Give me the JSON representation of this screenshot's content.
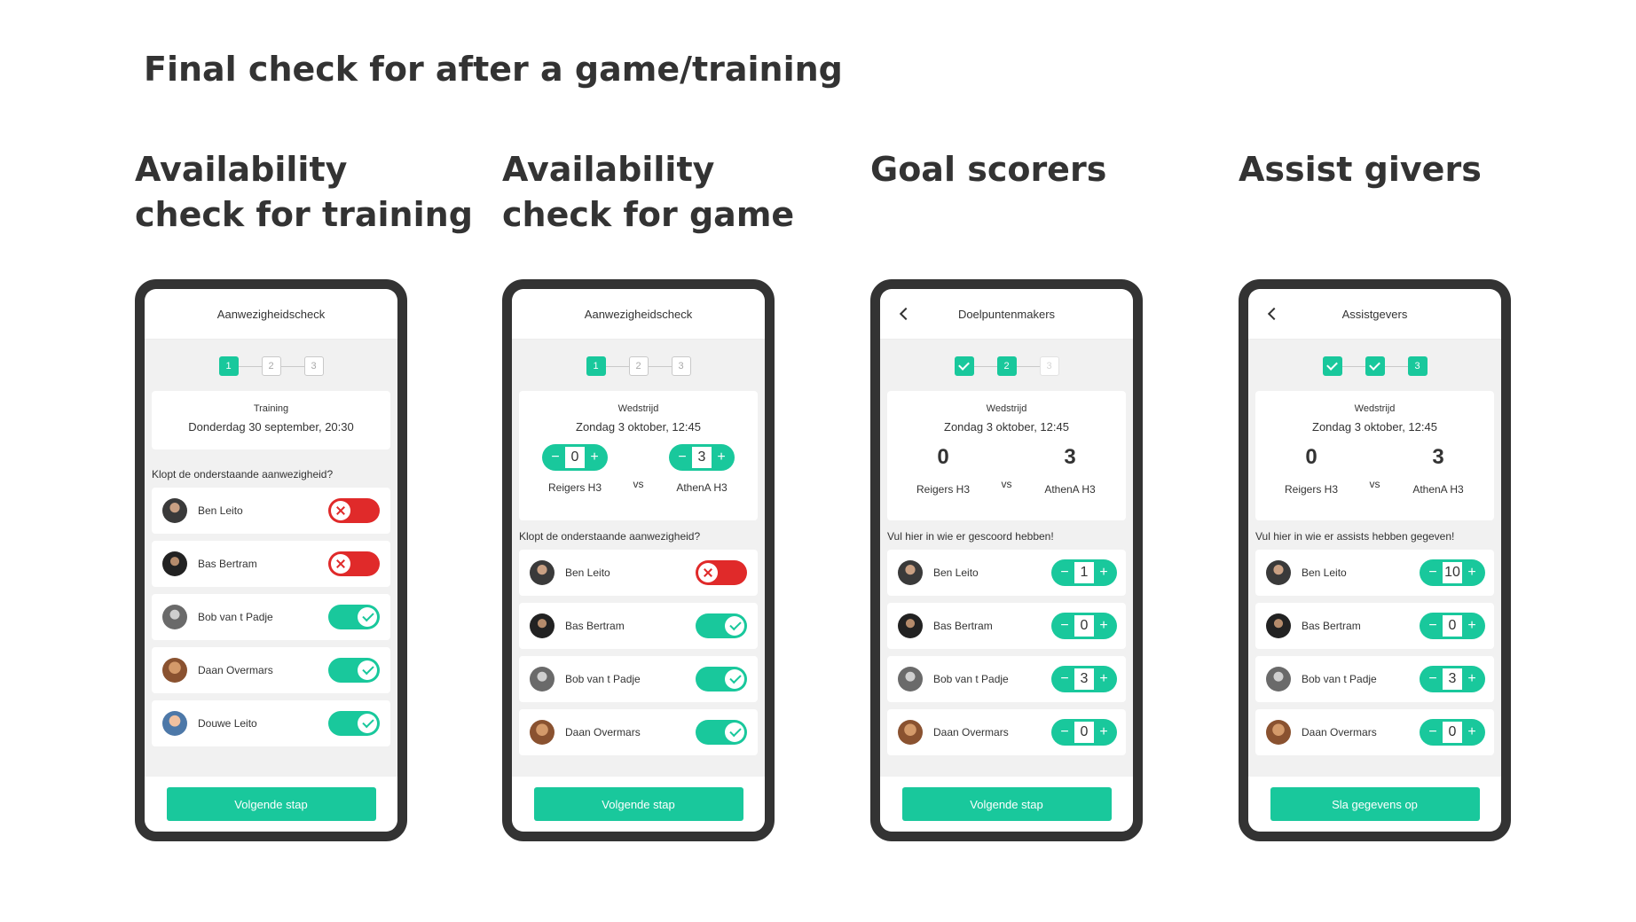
{
  "main_title": "Final check for after a game/training",
  "colors": {
    "accent": "#19c89c",
    "danger": "#e02a2a",
    "dark": "#333333"
  },
  "columns": [
    {
      "title": "Availability\ncheck for training"
    },
    {
      "title": "Availability\ncheck for game"
    },
    {
      "title": "Goal scorers"
    },
    {
      "title": "Assist givers"
    }
  ],
  "screens": [
    {
      "header": "Aanwezigheidscheck",
      "steps": [
        "1",
        "2",
        "3"
      ],
      "kind": "Training",
      "date": "Donderdag 30 september, 20:30",
      "question": "Klopt de onderstaande aanwezigheid?",
      "players": [
        {
          "name": "Ben Leito",
          "available": false
        },
        {
          "name": "Bas Bertram",
          "available": false
        },
        {
          "name": "Bob van t Padje",
          "available": true
        },
        {
          "name": "Daan Overmars",
          "available": true
        },
        {
          "name": "Douwe Leito",
          "available": true
        }
      ],
      "cta": "Volgende stap"
    },
    {
      "header": "Aanwezigheidscheck",
      "steps": [
        "1",
        "2",
        "3"
      ],
      "kind": "Wedstrijd",
      "date": "Zondag 3 oktober, 12:45",
      "home": {
        "name": "Reigers H3",
        "score": "0"
      },
      "away": {
        "name": "AthenA H3",
        "score": "3"
      },
      "vs": "vs",
      "question": "Klopt de onderstaande aanwezigheid?",
      "players": [
        {
          "name": "Ben Leito",
          "available": false
        },
        {
          "name": "Bas Bertram",
          "available": true
        },
        {
          "name": "Bob van t Padje",
          "available": true
        },
        {
          "name": "Daan Overmars",
          "available": true
        }
      ],
      "cta": "Volgende stap"
    },
    {
      "header": "Doelpuntenmakers",
      "steps": [
        "",
        "2",
        "3"
      ],
      "kind": "Wedstrijd",
      "date": "Zondag 3 oktober, 12:45",
      "home": {
        "name": "Reigers H3",
        "score": "0"
      },
      "away": {
        "name": "AthenA H3",
        "score": "3"
      },
      "vs": "vs",
      "question": "Vul hier in wie er gescoord hebben!",
      "players": [
        {
          "name": "Ben Leito",
          "count": "1"
        },
        {
          "name": "Bas Bertram",
          "count": "0"
        },
        {
          "name": "Bob van t Padje",
          "count": "3"
        },
        {
          "name": "Daan Overmars",
          "count": "0"
        }
      ],
      "cta": "Volgende stap"
    },
    {
      "header": "Assistgevers",
      "steps": [
        "",
        "",
        "3"
      ],
      "kind": "Wedstrijd",
      "date": "Zondag 3 oktober, 12:45",
      "home": {
        "name": "Reigers H3",
        "score": "0"
      },
      "away": {
        "name": "AthenA H3",
        "score": "3"
      },
      "vs": "vs",
      "question": "Vul hier in wie er assists hebben gegeven!",
      "players": [
        {
          "name": "Ben Leito",
          "count": "10"
        },
        {
          "name": "Bas Bertram",
          "count": "0"
        },
        {
          "name": "Bob van t Padje",
          "count": "3"
        },
        {
          "name": "Daan Overmars",
          "count": "0"
        }
      ],
      "cta": "Sla gegevens op"
    }
  ],
  "stepper_symbols": {
    "minus": "−",
    "plus": "+"
  }
}
